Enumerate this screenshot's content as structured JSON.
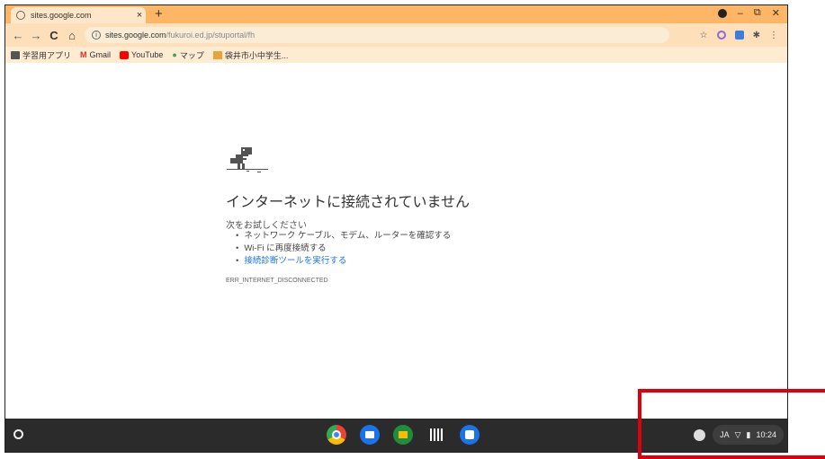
{
  "browser": {
    "tab_title": "sites.google.com",
    "close_glyph": "×",
    "newtab_glyph": "+",
    "url_host": "sites.google.com",
    "url_path": "/fukuroi.ed.jp/stuportal/fh",
    "bookmarks": [
      "学習用アプリ",
      "Gmail",
      "YouTube",
      "マップ",
      "袋井市小中学生..."
    ]
  },
  "error_page": {
    "title": "インターネットに接続されていません",
    "try_text": "次をお試しください",
    "suggestions": [
      "ネットワーク ケーブル、モデム、ルーターを確認する",
      "Wi-Fi に再度接続する",
      "接続診断ツールを実行する"
    ],
    "error_code": "ERR_INTERNET_DISCONNECTED"
  },
  "shelf": {
    "ime": "JA",
    "time": "10:24",
    "app_icons": [
      "chrome-icon",
      "files-icon",
      "classroom-icon",
      "qr-icon",
      "camera-icon"
    ]
  },
  "colors": {
    "tabstrip": "#fcb666",
    "toolbar": "#fde0b9",
    "link": "#1a73e8",
    "shelf": "#2b2b2b",
    "highlight": "#e0000b"
  }
}
